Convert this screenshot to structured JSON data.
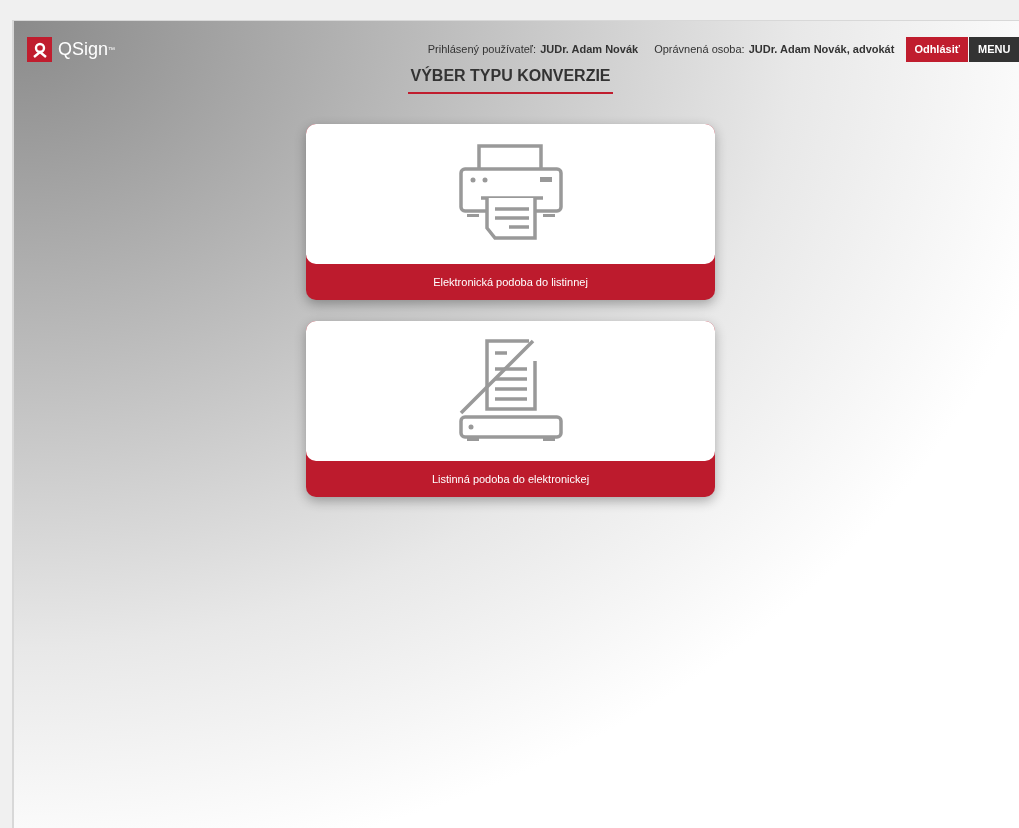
{
  "logo": {
    "text": "QSign",
    "mark": "™"
  },
  "header": {
    "user_label": "Prihlásený používateľ:",
    "user_name": "JUDr. Adam Novák",
    "person_label": "Oprávnená osoba:",
    "person_name": "JUDr. Adam Novák, advokát",
    "logout": "Odhlásiť",
    "menu": "MENU"
  },
  "title": "VÝBER TYPU KONVERZIE",
  "options": [
    {
      "kind": "print",
      "label": "Elektronická podoba do listinnej"
    },
    {
      "kind": "scan",
      "label": "Listinná podoba do elektronickej"
    }
  ]
}
